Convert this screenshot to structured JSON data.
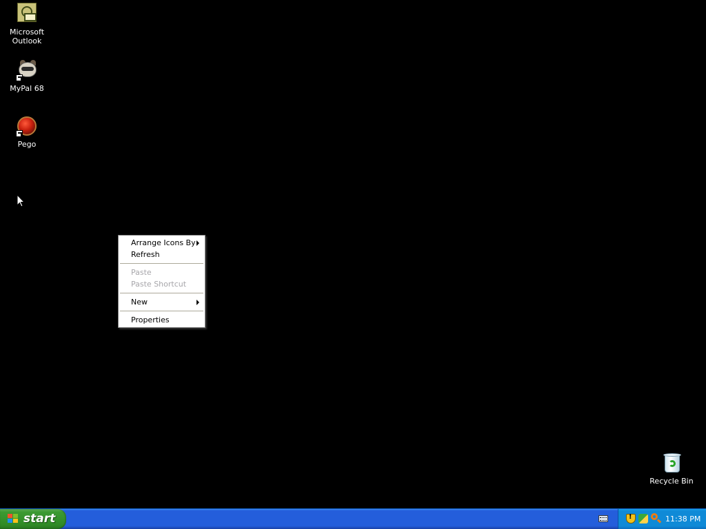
{
  "desktop": {
    "icons": [
      {
        "label_line1": "Microsoft",
        "label_line2": "Outlook",
        "icon": "outlook-icon"
      },
      {
        "label": "MyPal 68",
        "icon": "mypal-icon"
      },
      {
        "label": "Pego",
        "icon": "pego-icon"
      },
      {
        "label": "Recycle Bin",
        "icon": "recycle-bin-icon"
      }
    ]
  },
  "context_menu": {
    "items": [
      {
        "label": "Arrange Icons By",
        "enabled": true,
        "submenu": true
      },
      {
        "label": "Refresh",
        "enabled": true,
        "submenu": false
      },
      {
        "label": "Paste",
        "enabled": false,
        "submenu": false
      },
      {
        "label": "Paste Shortcut",
        "enabled": false,
        "submenu": false
      },
      {
        "label": "New",
        "enabled": true,
        "submenu": true
      },
      {
        "label": "Properties",
        "enabled": true,
        "submenu": false
      }
    ]
  },
  "taskbar": {
    "start_label": "start",
    "clock": "11:38 PM",
    "tray_icons": [
      "keyboard-icon",
      "security-shield-icon",
      "network-icon",
      "search-icon"
    ]
  },
  "colors": {
    "desktop_background": "#000000",
    "taskbar_blue": "#245edb",
    "start_green": "#3c9a32",
    "tray_blue": "#0f8ad7",
    "disabled_text": "#a7a6aa"
  }
}
